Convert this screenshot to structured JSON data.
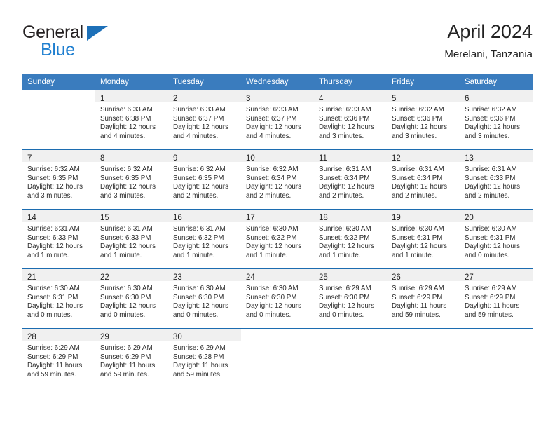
{
  "brand": {
    "name_top": "General",
    "name_bottom": "Blue",
    "triangle_color": "#1d70b8",
    "blue_text_color": "#1f7fd0"
  },
  "header": {
    "title": "April 2024",
    "subtitle": "Merelani, Tanzania"
  },
  "theme": {
    "header_blue": "#3a7cbe",
    "separator_blue": "#1c6cb0",
    "date_band_gray": "#f0f0f0"
  },
  "weekday_headers": [
    "Sunday",
    "Monday",
    "Tuesday",
    "Wednesday",
    "Thursday",
    "Friday",
    "Saturday"
  ],
  "weeks": [
    [
      {
        "day": ""
      },
      {
        "day": "1",
        "sunrise": "Sunrise: 6:33 AM",
        "sunset": "Sunset: 6:38 PM",
        "daylight": "Daylight: 12 hours and 4 minutes."
      },
      {
        "day": "2",
        "sunrise": "Sunrise: 6:33 AM",
        "sunset": "Sunset: 6:37 PM",
        "daylight": "Daylight: 12 hours and 4 minutes."
      },
      {
        "day": "3",
        "sunrise": "Sunrise: 6:33 AM",
        "sunset": "Sunset: 6:37 PM",
        "daylight": "Daylight: 12 hours and 4 minutes."
      },
      {
        "day": "4",
        "sunrise": "Sunrise: 6:33 AM",
        "sunset": "Sunset: 6:36 PM",
        "daylight": "Daylight: 12 hours and 3 minutes."
      },
      {
        "day": "5",
        "sunrise": "Sunrise: 6:32 AM",
        "sunset": "Sunset: 6:36 PM",
        "daylight": "Daylight: 12 hours and 3 minutes."
      },
      {
        "day": "6",
        "sunrise": "Sunrise: 6:32 AM",
        "sunset": "Sunset: 6:36 PM",
        "daylight": "Daylight: 12 hours and 3 minutes."
      }
    ],
    [
      {
        "day": "7",
        "sunrise": "Sunrise: 6:32 AM",
        "sunset": "Sunset: 6:35 PM",
        "daylight": "Daylight: 12 hours and 3 minutes."
      },
      {
        "day": "8",
        "sunrise": "Sunrise: 6:32 AM",
        "sunset": "Sunset: 6:35 PM",
        "daylight": "Daylight: 12 hours and 3 minutes."
      },
      {
        "day": "9",
        "sunrise": "Sunrise: 6:32 AM",
        "sunset": "Sunset: 6:35 PM",
        "daylight": "Daylight: 12 hours and 2 minutes."
      },
      {
        "day": "10",
        "sunrise": "Sunrise: 6:32 AM",
        "sunset": "Sunset: 6:34 PM",
        "daylight": "Daylight: 12 hours and 2 minutes."
      },
      {
        "day": "11",
        "sunrise": "Sunrise: 6:31 AM",
        "sunset": "Sunset: 6:34 PM",
        "daylight": "Daylight: 12 hours and 2 minutes."
      },
      {
        "day": "12",
        "sunrise": "Sunrise: 6:31 AM",
        "sunset": "Sunset: 6:34 PM",
        "daylight": "Daylight: 12 hours and 2 minutes."
      },
      {
        "day": "13",
        "sunrise": "Sunrise: 6:31 AM",
        "sunset": "Sunset: 6:33 PM",
        "daylight": "Daylight: 12 hours and 2 minutes."
      }
    ],
    [
      {
        "day": "14",
        "sunrise": "Sunrise: 6:31 AM",
        "sunset": "Sunset: 6:33 PM",
        "daylight": "Daylight: 12 hours and 1 minute."
      },
      {
        "day": "15",
        "sunrise": "Sunrise: 6:31 AM",
        "sunset": "Sunset: 6:33 PM",
        "daylight": "Daylight: 12 hours and 1 minute."
      },
      {
        "day": "16",
        "sunrise": "Sunrise: 6:31 AM",
        "sunset": "Sunset: 6:32 PM",
        "daylight": "Daylight: 12 hours and 1 minute."
      },
      {
        "day": "17",
        "sunrise": "Sunrise: 6:30 AM",
        "sunset": "Sunset: 6:32 PM",
        "daylight": "Daylight: 12 hours and 1 minute."
      },
      {
        "day": "18",
        "sunrise": "Sunrise: 6:30 AM",
        "sunset": "Sunset: 6:32 PM",
        "daylight": "Daylight: 12 hours and 1 minute."
      },
      {
        "day": "19",
        "sunrise": "Sunrise: 6:30 AM",
        "sunset": "Sunset: 6:31 PM",
        "daylight": "Daylight: 12 hours and 1 minute."
      },
      {
        "day": "20",
        "sunrise": "Sunrise: 6:30 AM",
        "sunset": "Sunset: 6:31 PM",
        "daylight": "Daylight: 12 hours and 0 minutes."
      }
    ],
    [
      {
        "day": "21",
        "sunrise": "Sunrise: 6:30 AM",
        "sunset": "Sunset: 6:31 PM",
        "daylight": "Daylight: 12 hours and 0 minutes."
      },
      {
        "day": "22",
        "sunrise": "Sunrise: 6:30 AM",
        "sunset": "Sunset: 6:30 PM",
        "daylight": "Daylight: 12 hours and 0 minutes."
      },
      {
        "day": "23",
        "sunrise": "Sunrise: 6:30 AM",
        "sunset": "Sunset: 6:30 PM",
        "daylight": "Daylight: 12 hours and 0 minutes."
      },
      {
        "day": "24",
        "sunrise": "Sunrise: 6:30 AM",
        "sunset": "Sunset: 6:30 PM",
        "daylight": "Daylight: 12 hours and 0 minutes."
      },
      {
        "day": "25",
        "sunrise": "Sunrise: 6:29 AM",
        "sunset": "Sunset: 6:30 PM",
        "daylight": "Daylight: 12 hours and 0 minutes."
      },
      {
        "day": "26",
        "sunrise": "Sunrise: 6:29 AM",
        "sunset": "Sunset: 6:29 PM",
        "daylight": "Daylight: 11 hours and 59 minutes."
      },
      {
        "day": "27",
        "sunrise": "Sunrise: 6:29 AM",
        "sunset": "Sunset: 6:29 PM",
        "daylight": "Daylight: 11 hours and 59 minutes."
      }
    ],
    [
      {
        "day": "28",
        "sunrise": "Sunrise: 6:29 AM",
        "sunset": "Sunset: 6:29 PM",
        "daylight": "Daylight: 11 hours and 59 minutes."
      },
      {
        "day": "29",
        "sunrise": "Sunrise: 6:29 AM",
        "sunset": "Sunset: 6:29 PM",
        "daylight": "Daylight: 11 hours and 59 minutes."
      },
      {
        "day": "30",
        "sunrise": "Sunrise: 6:29 AM",
        "sunset": "Sunset: 6:28 PM",
        "daylight": "Daylight: 11 hours and 59 minutes."
      },
      {
        "day": ""
      },
      {
        "day": ""
      },
      {
        "day": ""
      },
      {
        "day": ""
      }
    ]
  ]
}
